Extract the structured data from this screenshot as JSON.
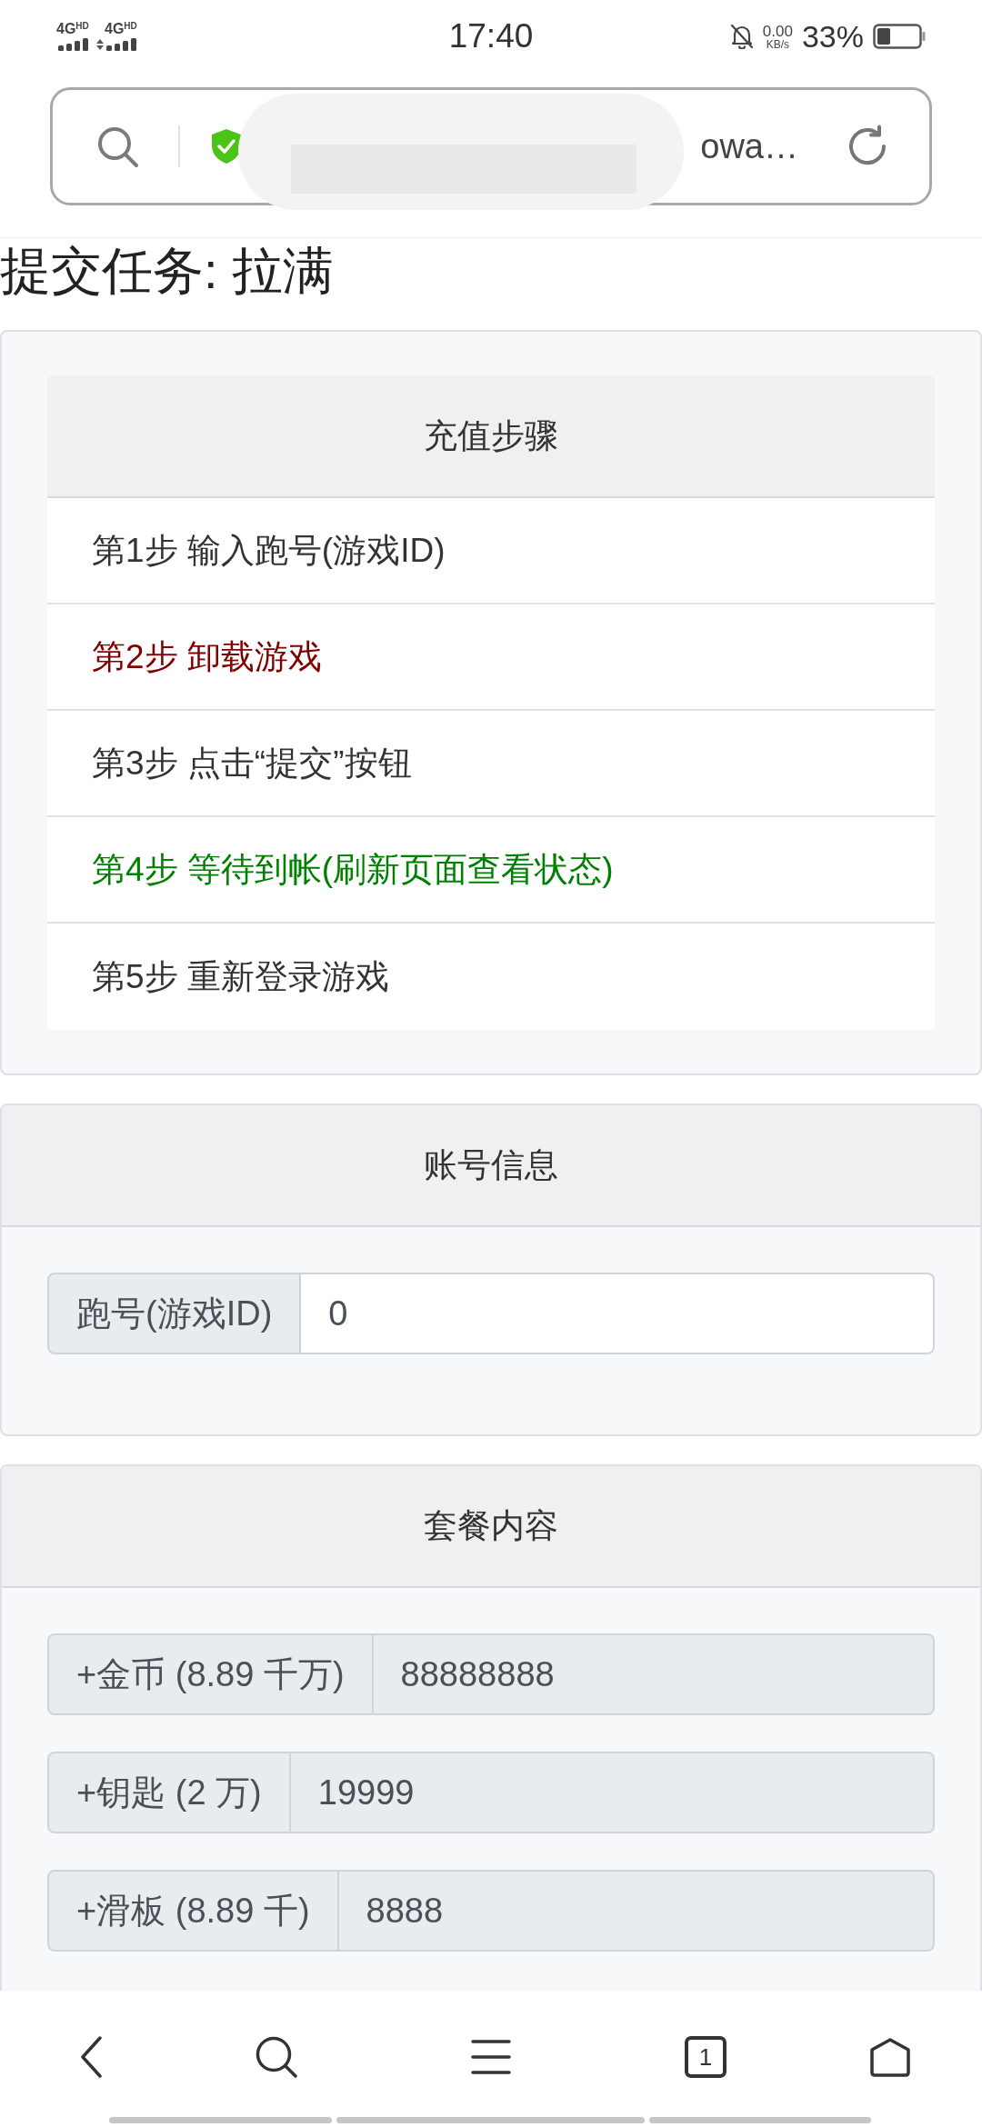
{
  "status_bar": {
    "networks": [
      {
        "label": "4G",
        "badge": "HD",
        "activity": false
      },
      {
        "label": "4G",
        "badge": "HD",
        "activity": true
      }
    ],
    "time": "17:40",
    "speed_value": "0.00",
    "speed_unit": "KB/s",
    "battery": "33%"
  },
  "address_bar": {
    "url": "owa…"
  },
  "page_title": "提交任务: 拉满",
  "steps_panel": {
    "title": "充值步骤",
    "steps": [
      {
        "text": "第1步 输入跑号(游戏ID)",
        "color": "#333333"
      },
      {
        "text": "第2步 卸载游戏",
        "color": "#800000"
      },
      {
        "text": "第3步 点击“提交”按钮",
        "color": "#333333"
      },
      {
        "text": "第4步 等待到帐(刷新页面查看状态)",
        "color": "#008000"
      },
      {
        "text": "第5步 重新登录游戏",
        "color": "#333333"
      }
    ]
  },
  "account_panel": {
    "title": "账号信息",
    "fields": [
      {
        "label": "跑号(游戏ID)",
        "value": "0",
        "readonly": false
      }
    ]
  },
  "package_panel": {
    "title": "套餐内容",
    "fields": [
      {
        "label": "+金币 (8.89 千万)",
        "value": "88888888",
        "readonly": true
      },
      {
        "label": "+钥匙 (2 万)",
        "value": "19999",
        "readonly": true
      },
      {
        "label": "+滑板 (8.89 千)",
        "value": "8888",
        "readonly": true
      }
    ]
  },
  "bottom_nav": {
    "tab_count": "1"
  }
}
